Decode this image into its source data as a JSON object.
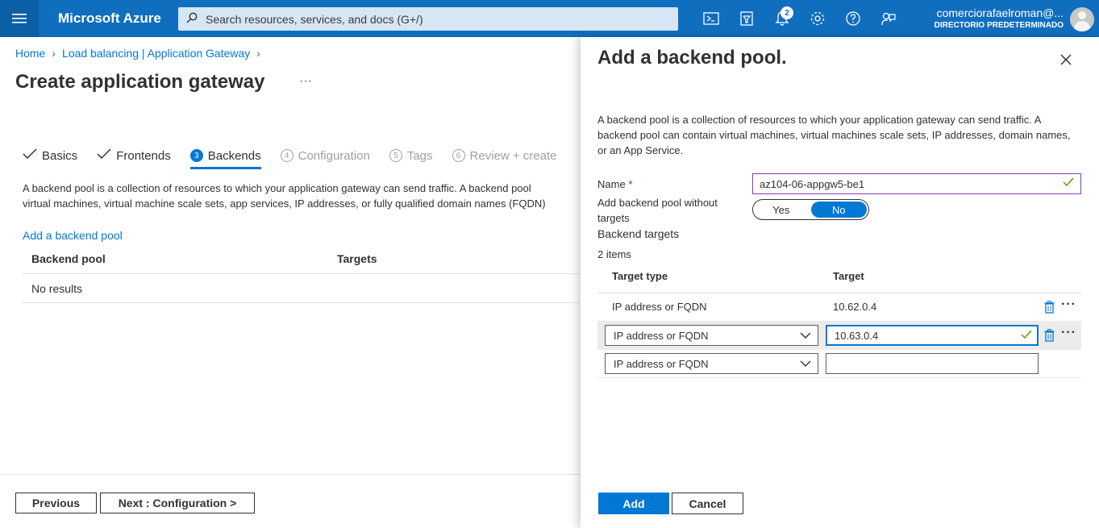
{
  "topbar": {
    "brand": "Microsoft Azure",
    "search_placeholder": "Search resources, services, and docs (G+/)",
    "notifications_count": "2",
    "account_email": "comerciorafaelroman@...",
    "account_directory": "DIRECTORIO PREDETERMINADO",
    "icons": [
      "cloud-shell-icon",
      "directory-filter-icon",
      "notifications-icon",
      "settings-icon",
      "help-icon",
      "feedback-icon"
    ]
  },
  "breadcrumb": [
    "Home",
    "Load balancing | Application Gateway"
  ],
  "page": {
    "title": "Create application gateway",
    "more": "···"
  },
  "steps": [
    {
      "num": "",
      "label": "Basics",
      "state": "done"
    },
    {
      "num": "",
      "label": "Frontends",
      "state": "done"
    },
    {
      "num": "3",
      "label": "Backends",
      "state": "active"
    },
    {
      "num": "4",
      "label": "Configuration",
      "state": "disabled"
    },
    {
      "num": "5",
      "label": "Tags",
      "state": "disabled"
    },
    {
      "num": "6",
      "label": "Review + create",
      "state": "disabled"
    }
  ],
  "main": {
    "description_line1": "A backend pool is a collection of resources to which your application gateway can send traffic. A backend pool",
    "description_line2": "virtual machines, virtual machine scale sets, app services, IP addresses, or fully qualified domain names (FQDN)",
    "add_link": "Add a backend pool",
    "columns": [
      "Backend pool",
      "Targets"
    ],
    "empty": "No results"
  },
  "footer": {
    "previous": "Previous",
    "next": "Next : Configuration >"
  },
  "panel": {
    "title": "Add a backend pool.",
    "description": "A backend pool is a collection of resources to which your application gateway can send traffic. A backend pool can contain virtual machines, virtual machines scale sets, IP addresses, domain names, or an App Service.",
    "name_label": "Name",
    "name_value": "az104-06-appgw5-be1",
    "without_targets_label": "Add backend pool without targets",
    "toggle": {
      "yes": "Yes",
      "no": "No",
      "selected": "No"
    },
    "targets_label": "Backend targets",
    "count": "2 items",
    "columns": [
      "Target type",
      "Target"
    ],
    "rows": [
      {
        "type": "IP address or FQDN",
        "target": "10.62.0.4"
      },
      {
        "type": "IP address or FQDN",
        "target": "10.63.0.4"
      },
      {
        "type": "IP address or FQDN",
        "target": ""
      }
    ],
    "add_button": "Add",
    "cancel_button": "Cancel"
  },
  "colors": {
    "brand_blue": "#0078d4",
    "topbar": "#106ebe",
    "success_green": "#57a300",
    "required_red": "#a4262c"
  }
}
